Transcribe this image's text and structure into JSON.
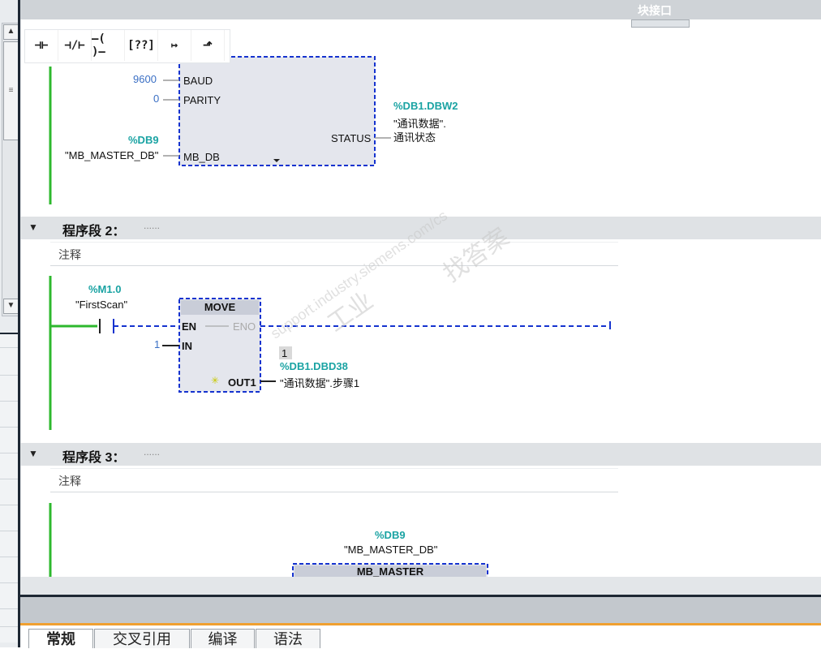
{
  "header": {
    "block_interface_label": "块接口"
  },
  "toolbar": {
    "buttons": [
      {
        "icon": "normally-open-contact-icon",
        "glyph": "⊣⊢"
      },
      {
        "icon": "normally-closed-contact-icon",
        "glyph": "⊣/⊢"
      },
      {
        "icon": "coil-icon",
        "glyph": "–( )–"
      },
      {
        "icon": "empty-box-icon",
        "glyph": "[??]"
      },
      {
        "icon": "open-branch-icon",
        "glyph": "↦"
      },
      {
        "icon": "close-branch-icon",
        "glyph": "⬏"
      }
    ]
  },
  "network1": {
    "inputs": [
      {
        "value": "9600",
        "pin": "BAUD"
      },
      {
        "value": "0",
        "pin": "PARITY"
      }
    ],
    "mb_db_addr": "%DB9",
    "mb_db_value": "\"MB_MASTER_DB\"",
    "mb_db_pin": "MB_DB",
    "status_pin": "STATUS",
    "status_addr": "%DB1.DBW2",
    "status_line1": "\"通讯数据\".",
    "status_line2": "通讯状态"
  },
  "network2": {
    "title": "程序段 2：",
    "dots": "......",
    "comment": "注释",
    "contact_addr": "%M1.0",
    "contact_name": "\"FirstScan\"",
    "box_title": "MOVE",
    "en": "EN",
    "eno": "ENO",
    "in_value": "1",
    "in_pin": "IN",
    "out_pin": "OUT1",
    "out_monitor": "1",
    "out_addr": "%DB1.DBD38",
    "out_name": "\"通讯数据\".步骤1"
  },
  "network3": {
    "title": "程序段 3：",
    "dots": "......",
    "comment": "注释",
    "db_addr": "%DB9",
    "db_name": "\"MB_MASTER_DB\"",
    "box_title": "MB_MASTER"
  },
  "watermark": {
    "line1": "找答案",
    "line2": "工业",
    "line3": "support.industry.siemens.com/cs"
  },
  "bottom_tabs": [
    "常规",
    "交叉引用",
    "编译",
    "语法"
  ],
  "colors": {
    "wire_power": "#2db82d",
    "wire_dashed": "#1533cf",
    "address": "#1aa3a3",
    "constant": "#3a6fc4",
    "accent": "#f0a030"
  }
}
